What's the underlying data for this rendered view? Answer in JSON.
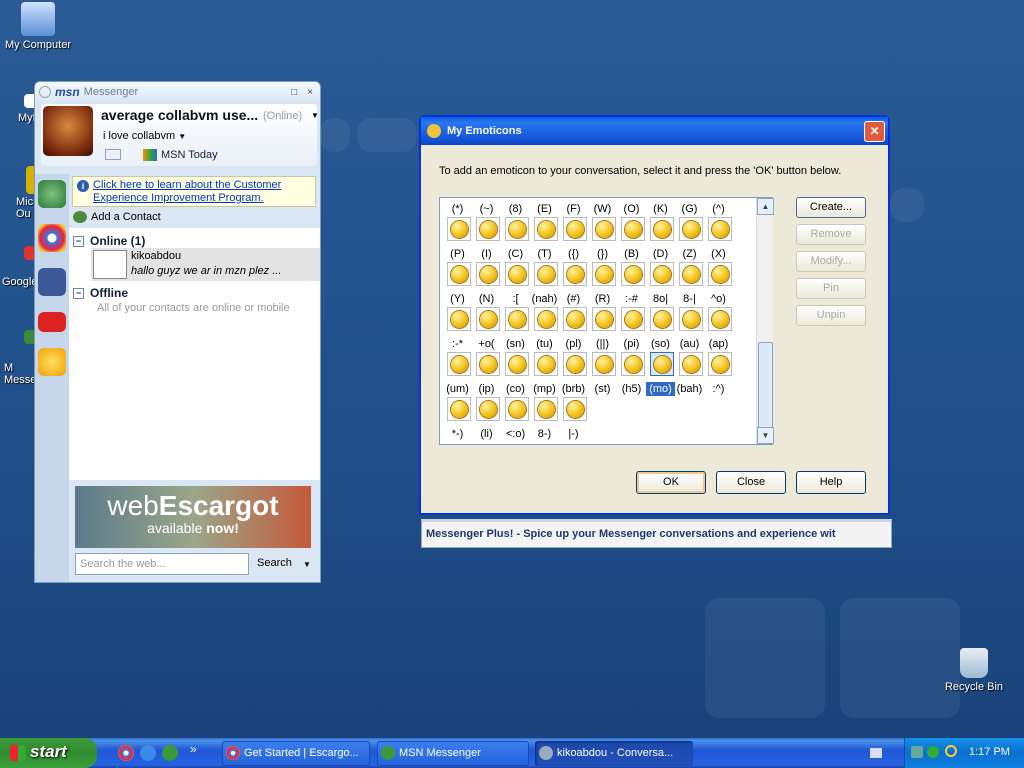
{
  "desktop": {
    "icons": [
      {
        "label": "My Computer"
      },
      {
        "label": "MyF"
      },
      {
        "label": "Micr Ou"
      },
      {
        "label": "Google"
      },
      {
        "label": "M Messe"
      },
      {
        "label": "Recycle Bin"
      }
    ]
  },
  "msn": {
    "logo": "msn",
    "title": "Messenger",
    "window_buttons": [
      "□",
      "×"
    ],
    "username": "average collabvm use...",
    "status": "(Online)",
    "personal_message": "i love collabvm",
    "msn_today": "MSN Today",
    "notice_line1": "Click here to learn about the Customer",
    "notice_line2": "Experience Improvement Program.",
    "add_contact": "Add a Contact",
    "group_online": "Online (1)",
    "group_offline": "Offline",
    "toggle_symbol": "−",
    "contact_name": "kikoabdou",
    "contact_message": "hallo guyz we ar in mzn plez ...",
    "offline_message": "All of your contacts are online or mobile",
    "ad_brand_light": "web",
    "ad_brand_bold": "Escargot",
    "ad_tagline_light": "available ",
    "ad_tagline_bold": "now!",
    "search_placeholder": "Search the web...",
    "search_button": "Search"
  },
  "dialog": {
    "title": "My Emoticons",
    "close_glyph": "✕",
    "instruction": "To add an emoticon to your conversation, select it and press the 'OK' button below.",
    "label_rows": [
      [
        "(*)",
        "(~)",
        "(8)",
        "(E)",
        "(F)",
        "(W)",
        "(O)",
        "(K)",
        "(G)",
        "(^)"
      ],
      [
        "(P)",
        "(I)",
        "(C)",
        "(T)",
        "({)",
        "(})",
        "(B)",
        "(D)",
        "(Z)",
        "(X)"
      ],
      [
        "(Y)",
        "(N)",
        ":[",
        "(nah)",
        "(#)",
        "(R)",
        ":-#",
        "8o|",
        "8-|",
        "^o)"
      ],
      [
        ":-*",
        "+o(",
        "(sn)",
        "(tu)",
        "(pl)",
        "(||)",
        "(pi)",
        "(so)",
        "(au)",
        "(ap)"
      ],
      [
        "(um)",
        "(ip)",
        "(co)",
        "(mp)",
        "(brb)",
        "(st)",
        "(h5)",
        "(mo)",
        "(bah)",
        ":^)"
      ],
      [
        "*-)",
        "(li)",
        "<:o)",
        "8-)",
        "|-)"
      ]
    ],
    "selected_label": "(mo)",
    "buttons_right": [
      "Create...",
      "Remove",
      "Modify...",
      "Pin",
      "Unpin"
    ],
    "buttons_bottom": [
      "OK",
      "Close",
      "Help"
    ]
  },
  "messenger_plus": "Messenger Plus! - Spice up your Messenger conversations and experience wit",
  "taskbar": {
    "start": "start",
    "overflow": "»",
    "tasks": [
      "Get Started | Escargo...",
      "MSN Messenger",
      "kikoabdou - Conversa..."
    ],
    "clock": "1:17 PM"
  }
}
